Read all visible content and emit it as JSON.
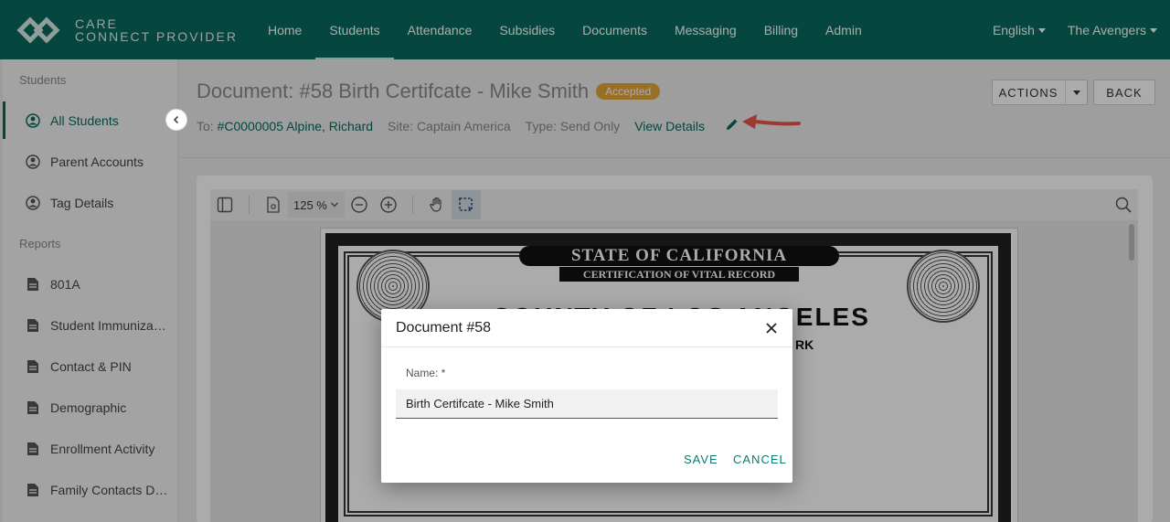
{
  "app": {
    "logo_line1": "CARE",
    "logo_line2": "CONNECT PROVIDER"
  },
  "nav": {
    "items": [
      "Home",
      "Students",
      "Attendance",
      "Subsidies",
      "Documents",
      "Messaging",
      "Billing",
      "Admin"
    ],
    "active": "Students",
    "language": "English",
    "account": "The Avengers"
  },
  "sidebar": {
    "students_heading": "Students",
    "students_items": [
      "All Students",
      "Parent Accounts",
      "Tag Details"
    ],
    "reports_heading": "Reports",
    "reports_items": [
      "801A",
      "Student Immuniza…",
      "Contact & PIN",
      "Demographic",
      "Enrollment Activity",
      "Family Contacts D…"
    ]
  },
  "header": {
    "title": "Document: #58 Birth Certifcate - Mike Smith",
    "status_badge": "Accepted",
    "to_label": "To:",
    "to_value": "#C0000005 Alpine, Richard",
    "site": "Site: Captain America",
    "type": "Type: Send Only",
    "view_details": "View Details",
    "actions_label": "ACTIONS",
    "back_label": "BACK"
  },
  "viewer": {
    "zoom": "125 %"
  },
  "certificate": {
    "banner": "STATE OF CALIFORNIA",
    "subtitle": "CERTIFICATION OF VITAL RECORD",
    "county": "COUNTY OF LOS ANGELES",
    "fragment": "RK"
  },
  "dialog": {
    "title": "Document #58",
    "name_label": "Name: *",
    "name_value": "Birth Certifcate - Mike Smith",
    "save_label": "SAVE",
    "cancel_label": "CANCEL"
  },
  "colors": {
    "brand": "#086b5e",
    "badge": "#e4a63a",
    "annotation_arrow": "#e8574b"
  }
}
